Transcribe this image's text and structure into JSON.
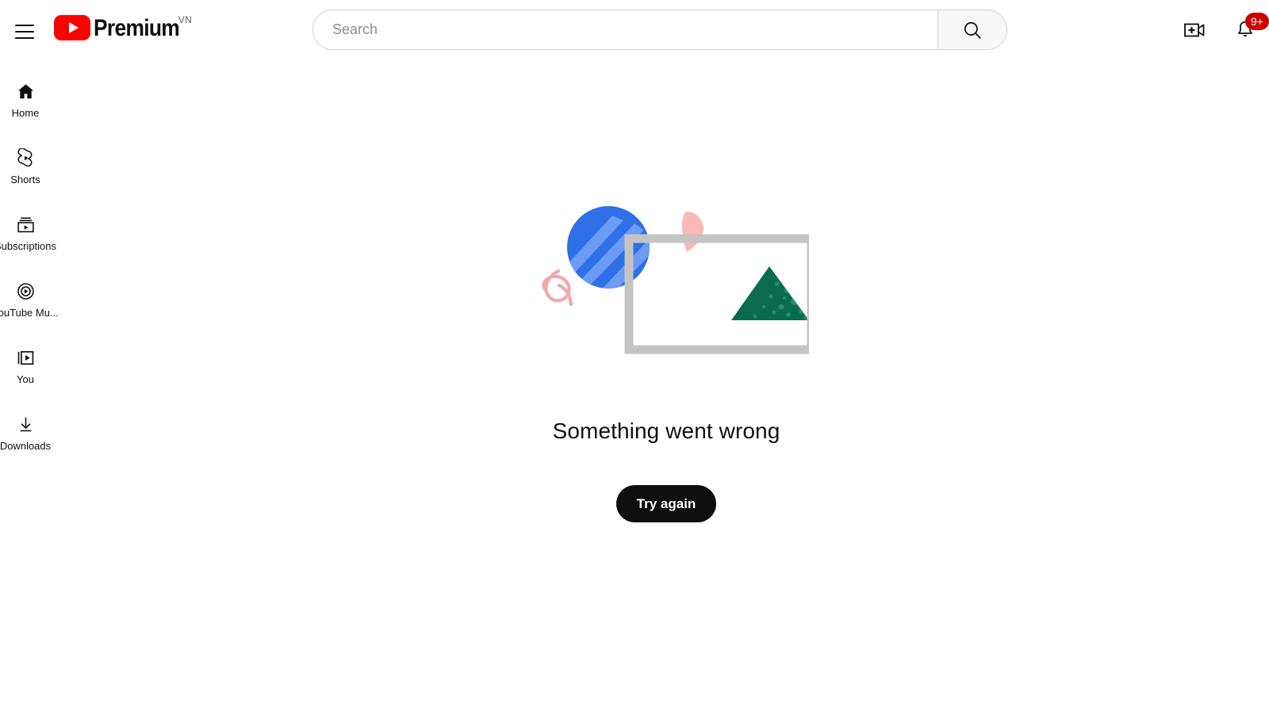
{
  "header": {
    "menu_icon": "hamburger-menu-icon",
    "logo_text": "Premium",
    "logo_country_code": "VN",
    "logo_play_icon": "youtube-play-icon",
    "search": {
      "placeholder": "Search",
      "value": "",
      "button_icon": "search-icon"
    },
    "create_icon": "create-video-icon",
    "notifications_icon": "bell-icon",
    "notifications_badge": "9+",
    "badge_color": "#cc0000",
    "brand_red": "#ff0000"
  },
  "sidebar": {
    "items": [
      {
        "label": "Home",
        "icon": "home-icon",
        "active": true
      },
      {
        "label": "Shorts",
        "icon": "shorts-icon",
        "active": false
      },
      {
        "label": "Subscriptions",
        "icon": "subscriptions-icon",
        "active": false
      },
      {
        "label": "YouTube Mu...",
        "icon": "youtube-music-icon",
        "active": false
      },
      {
        "label": "You",
        "icon": "you-library-icon",
        "active": false
      },
      {
        "label": "Downloads",
        "icon": "downloads-icon",
        "active": false
      }
    ]
  },
  "main": {
    "illustration": {
      "name": "something-went-wrong-illustration",
      "shapes": [
        {
          "name": "blue-circle",
          "color": "#2f6fe8",
          "stripe_color": "#6b9bf2"
        },
        {
          "name": "gray-rectangle-frame",
          "color": "#c4c4c4"
        },
        {
          "name": "green-triangle",
          "color": "#0b6b4f",
          "speckle_color": "#1f8f6c"
        },
        {
          "name": "pink-petal",
          "color": "#f9b9b9"
        },
        {
          "name": "pink-squiggle",
          "color": "#f2a9a9"
        }
      ]
    },
    "title": "Something went wrong",
    "retry_label": "Try again",
    "retry_bg": "#0f0f0f"
  }
}
